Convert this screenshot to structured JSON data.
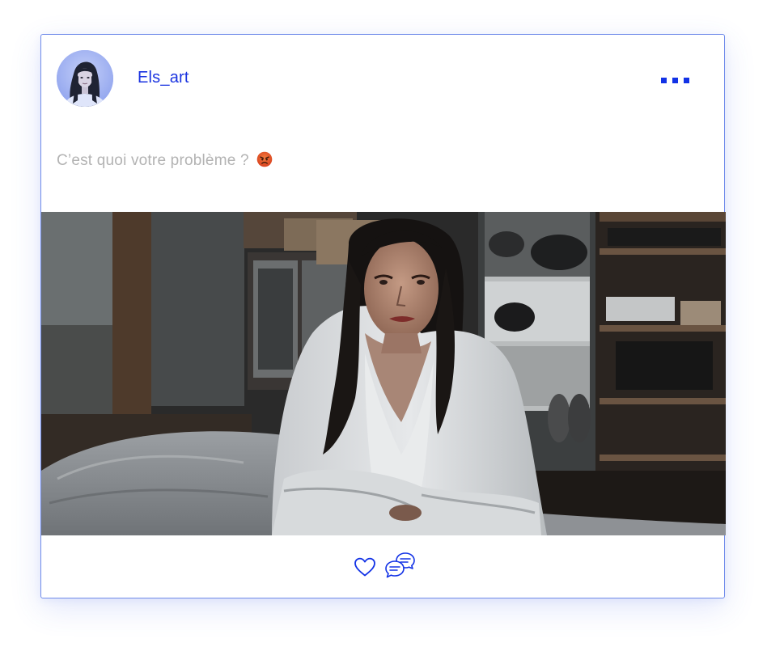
{
  "post": {
    "author": {
      "username": "Els_art",
      "avatar_icon": "user-avatar"
    },
    "caption": "C’est quoi votre problème ?",
    "caption_emoji": "angry-face",
    "menu_icon": "more-dots-icon",
    "actions": {
      "like_icon": "heart-icon",
      "comment_icon": "comment-bubbles-icon"
    }
  },
  "colors": {
    "accent": "#1232e6",
    "card_border": "#6f8bea",
    "caption_text": "#b3b3b3"
  }
}
